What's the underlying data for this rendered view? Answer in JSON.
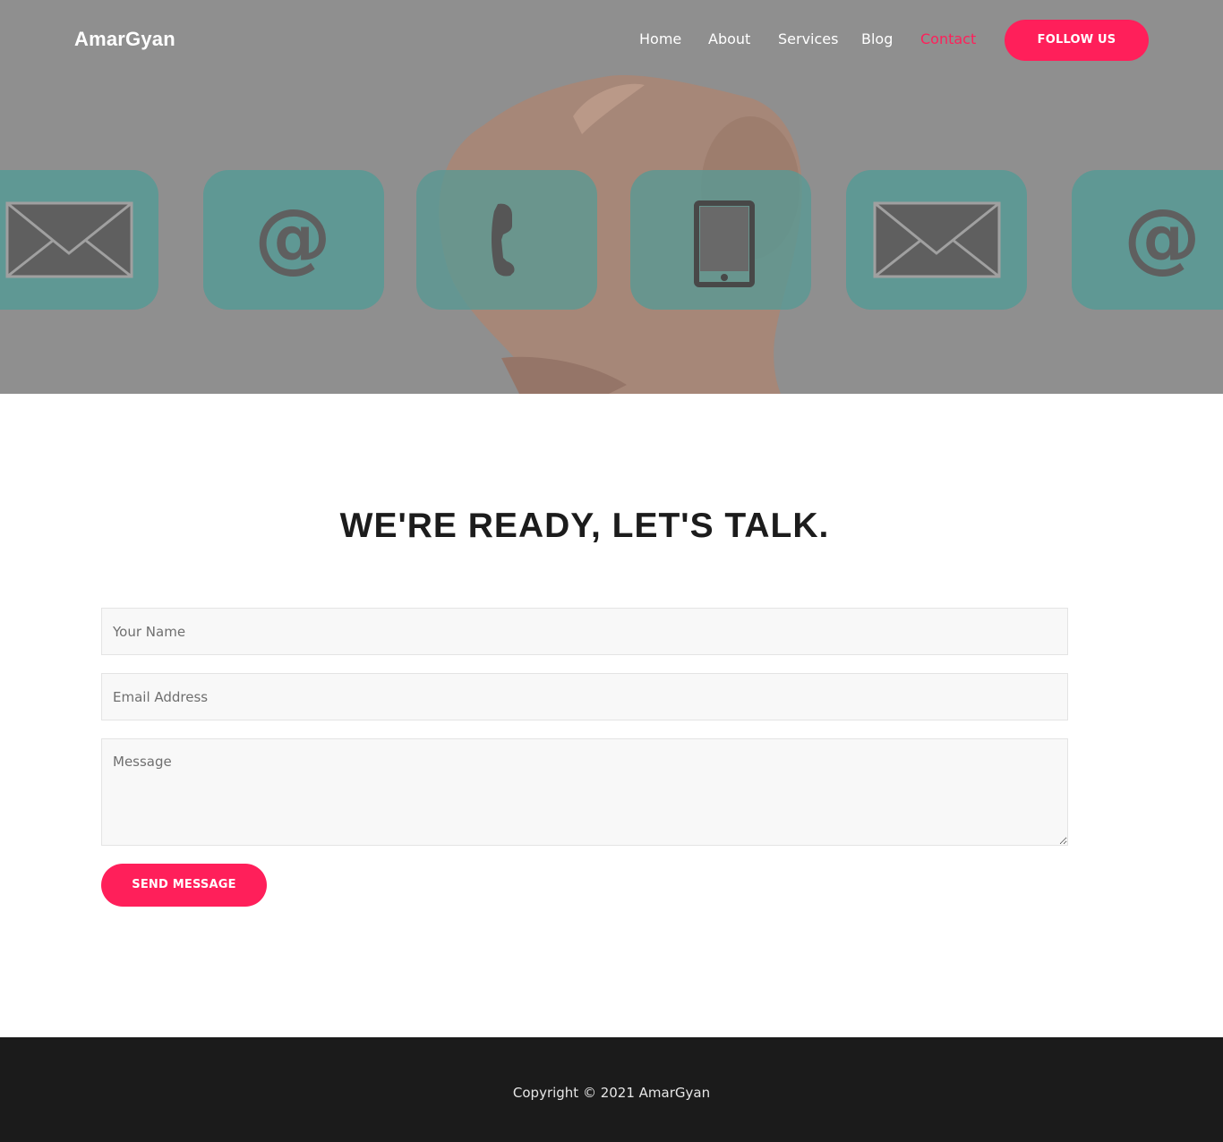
{
  "header": {
    "brand": "AmarGyan",
    "nav": [
      {
        "label": "Home",
        "active": false
      },
      {
        "label": "About",
        "active": false
      },
      {
        "label": "Services",
        "active": false
      },
      {
        "label": "Blog",
        "active": false
      },
      {
        "label": "Contact",
        "active": true
      }
    ],
    "follow_label": "FOLLOW US"
  },
  "hero": {
    "icons": [
      "envelope-icon",
      "at-sign-icon",
      "phone-icon",
      "mobile-icon",
      "envelope-icon",
      "at-sign-icon"
    ]
  },
  "contact": {
    "heading": "WE'RE READY, LET'S TALK.",
    "name_placeholder": "Your Name",
    "email_placeholder": "Email Address",
    "message_placeholder": "Message",
    "send_label": "SEND MESSAGE"
  },
  "footer": {
    "copyright": "Copyright © 2021 AmarGyan"
  },
  "colors": {
    "accent": "#ff1f5a",
    "hero_tile": "#52a09a",
    "footer_bg": "#1b1b1b"
  }
}
